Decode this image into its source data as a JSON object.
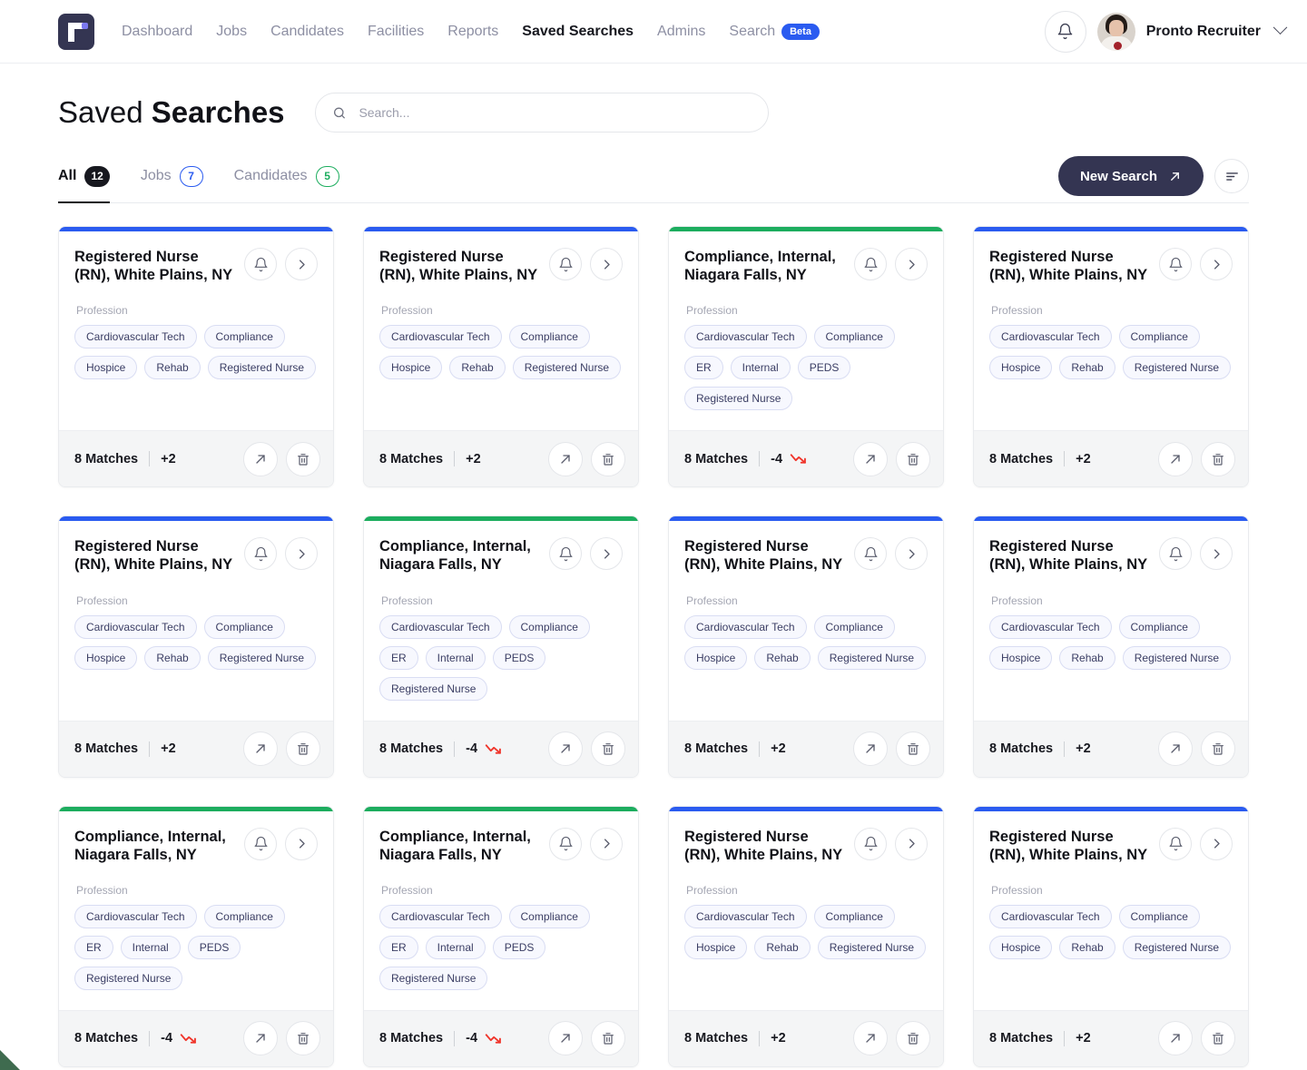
{
  "brand": {
    "logo_name": "pronto-logo",
    "accent_purple": "#7b78f0",
    "logo_bg": "#343552"
  },
  "nav": {
    "items": [
      {
        "label": "Dashboard",
        "active": false
      },
      {
        "label": "Jobs",
        "active": false
      },
      {
        "label": "Candidates",
        "active": false
      },
      {
        "label": "Facilities",
        "active": false
      },
      {
        "label": "Reports",
        "active": false
      },
      {
        "label": "Saved Searches",
        "active": true
      },
      {
        "label": "Admins",
        "active": false
      }
    ],
    "search_label": "Search",
    "search_badge": "Beta",
    "bell_icon": "bell-icon",
    "user_name": "Pronto Recruiter",
    "user_caret_icon": "chevron-down-icon"
  },
  "header": {
    "title_light": "Saved ",
    "title_bold": "Searches",
    "search_placeholder": "Search...",
    "search_value": "",
    "search_icon": "search-icon"
  },
  "tabs": [
    {
      "label": "All",
      "count": "12",
      "style": "dark",
      "active": true
    },
    {
      "label": "Jobs",
      "count": "7",
      "style": "blue",
      "active": false
    },
    {
      "label": "Candidates",
      "count": "5",
      "style": "green",
      "active": false
    }
  ],
  "actions": {
    "new_search_label": "New Search",
    "new_search_icon": "arrow-up-right-icon",
    "sort_icon": "sort-icon"
  },
  "colors": {
    "blue": "#2a5bf0",
    "green": "#1cad5e",
    "red": "#f0352b",
    "dark": "#343552"
  },
  "card_common": {
    "section_label": "Profession",
    "bell_icon": "bell-icon",
    "chevron_icon": "chevron-right-icon",
    "open_icon": "arrow-up-right-icon",
    "delete_icon": "trash-icon",
    "trend_down_icon": "trend-down-icon"
  },
  "cards": [
    {
      "accent": "#2a5bf0",
      "title": "Registered Nurse (RN), White Plains, NY",
      "chips": [
        "Cardiovascular Tech",
        "Compliance",
        "Hospice",
        "Rehab",
        "Registered Nurse"
      ],
      "matches": "8 Matches",
      "delta": "+2",
      "trend": "up"
    },
    {
      "accent": "#2a5bf0",
      "title": "Registered Nurse (RN), White Plains, NY",
      "chips": [
        "Cardiovascular Tech",
        "Compliance",
        "Hospice",
        "Rehab",
        "Registered Nurse"
      ],
      "matches": "8 Matches",
      "delta": "+2",
      "trend": "up"
    },
    {
      "accent": "#1cad5e",
      "title": "Compliance, Internal, Niagara Falls, NY",
      "chips": [
        "Cardiovascular Tech",
        "Compliance",
        "ER",
        "Internal",
        "PEDS",
        "Registered Nurse"
      ],
      "matches": "8 Matches",
      "delta": "-4",
      "trend": "down"
    },
    {
      "accent": "#2a5bf0",
      "title": "Registered Nurse (RN), White Plains, NY",
      "chips": [
        "Cardiovascular Tech",
        "Compliance",
        "Hospice",
        "Rehab",
        "Registered Nurse"
      ],
      "matches": "8 Matches",
      "delta": "+2",
      "trend": "up"
    },
    {
      "accent": "#2a5bf0",
      "title": "Registered Nurse (RN), White Plains, NY",
      "chips": [
        "Cardiovascular Tech",
        "Compliance",
        "Hospice",
        "Rehab",
        "Registered Nurse"
      ],
      "matches": "8 Matches",
      "delta": "+2",
      "trend": "up"
    },
    {
      "accent": "#1cad5e",
      "title": "Compliance, Internal, Niagara Falls, NY",
      "chips": [
        "Cardiovascular Tech",
        "Compliance",
        "ER",
        "Internal",
        "PEDS",
        "Registered Nurse"
      ],
      "matches": "8 Matches",
      "delta": "-4",
      "trend": "down"
    },
    {
      "accent": "#2a5bf0",
      "title": "Registered Nurse (RN), White Plains, NY",
      "chips": [
        "Cardiovascular Tech",
        "Compliance",
        "Hospice",
        "Rehab",
        "Registered Nurse"
      ],
      "matches": "8 Matches",
      "delta": "+2",
      "trend": "up"
    },
    {
      "accent": "#2a5bf0",
      "title": "Registered Nurse (RN), White Plains, NY",
      "chips": [
        "Cardiovascular Tech",
        "Compliance",
        "Hospice",
        "Rehab",
        "Registered Nurse"
      ],
      "matches": "8 Matches",
      "delta": "+2",
      "trend": "up"
    },
    {
      "accent": "#1cad5e",
      "title": "Compliance, Internal, Niagara Falls, NY",
      "chips": [
        "Cardiovascular Tech",
        "Compliance",
        "ER",
        "Internal",
        "PEDS",
        "Registered Nurse"
      ],
      "matches": "8 Matches",
      "delta": "-4",
      "trend": "down"
    },
    {
      "accent": "#1cad5e",
      "title": "Compliance, Internal, Niagara Falls, NY",
      "chips": [
        "Cardiovascular Tech",
        "Compliance",
        "ER",
        "Internal",
        "PEDS",
        "Registered Nurse"
      ],
      "matches": "8 Matches",
      "delta": "-4",
      "trend": "down"
    },
    {
      "accent": "#2a5bf0",
      "title": "Registered Nurse (RN), White Plains, NY",
      "chips": [
        "Cardiovascular Tech",
        "Compliance",
        "Hospice",
        "Rehab",
        "Registered Nurse"
      ],
      "matches": "8 Matches",
      "delta": "+2",
      "trend": "up"
    },
    {
      "accent": "#2a5bf0",
      "title": "Registered Nurse (RN), White Plains, NY",
      "chips": [
        "Cardiovascular Tech",
        "Compliance",
        "Hospice",
        "Rehab",
        "Registered Nurse"
      ],
      "matches": "8 Matches",
      "delta": "+2",
      "trend": "up"
    }
  ]
}
